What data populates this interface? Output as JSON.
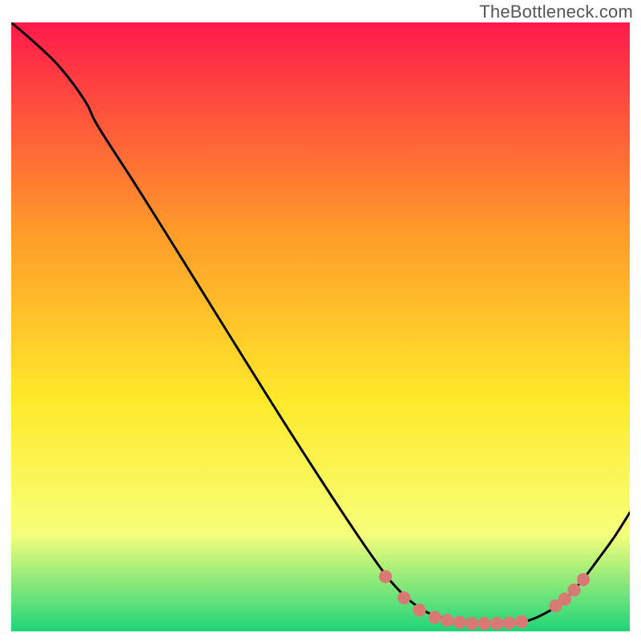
{
  "attribution": "TheBottleneck.com",
  "chart_data": {
    "type": "line",
    "title": "",
    "xlabel": "",
    "ylabel": "",
    "xlim": [
      0,
      100
    ],
    "ylim": [
      0,
      100
    ],
    "gradient_colors": {
      "top": "#ff1a4b",
      "mid_upper": "#ff9a2a",
      "mid": "#ffe92a",
      "mid_lower": "#f6ff7a",
      "bottom": "#1fd47a"
    },
    "curve_points": [
      {
        "x": 0.0,
        "y": 100.0
      },
      {
        "x": 4.0,
        "y": 96.5
      },
      {
        "x": 8.0,
        "y": 92.5
      },
      {
        "x": 12.0,
        "y": 87.0
      },
      {
        "x": 14.0,
        "y": 83.0
      },
      {
        "x": 20.0,
        "y": 73.5
      },
      {
        "x": 26.0,
        "y": 63.8
      },
      {
        "x": 32.0,
        "y": 54.0
      },
      {
        "x": 38.0,
        "y": 44.2
      },
      {
        "x": 44.0,
        "y": 34.5
      },
      {
        "x": 50.0,
        "y": 25.0
      },
      {
        "x": 56.0,
        "y": 15.8
      },
      {
        "x": 60.0,
        "y": 10.0
      },
      {
        "x": 62.0,
        "y": 7.5
      },
      {
        "x": 64.5,
        "y": 5.0
      },
      {
        "x": 67.5,
        "y": 3.0
      },
      {
        "x": 71.0,
        "y": 1.8
      },
      {
        "x": 74.0,
        "y": 1.3
      },
      {
        "x": 77.0,
        "y": 1.3
      },
      {
        "x": 80.0,
        "y": 1.3
      },
      {
        "x": 83.0,
        "y": 1.6
      },
      {
        "x": 86.0,
        "y": 2.8
      },
      {
        "x": 89.0,
        "y": 4.8
      },
      {
        "x": 92.0,
        "y": 8.0
      },
      {
        "x": 95.0,
        "y": 12.0
      },
      {
        "x": 97.5,
        "y": 15.5
      },
      {
        "x": 100.0,
        "y": 19.5
      }
    ],
    "dot_points": [
      {
        "x": 60.5,
        "y": 9.0
      },
      {
        "x": 63.5,
        "y": 5.5
      },
      {
        "x": 66.0,
        "y": 3.5
      },
      {
        "x": 68.5,
        "y": 2.3
      },
      {
        "x": 70.5,
        "y": 1.8
      },
      {
        "x": 72.5,
        "y": 1.5
      },
      {
        "x": 74.5,
        "y": 1.3
      },
      {
        "x": 76.5,
        "y": 1.3
      },
      {
        "x": 78.5,
        "y": 1.3
      },
      {
        "x": 80.5,
        "y": 1.4
      },
      {
        "x": 82.5,
        "y": 1.6
      },
      {
        "x": 88.0,
        "y": 4.2
      },
      {
        "x": 89.5,
        "y": 5.3
      },
      {
        "x": 91.0,
        "y": 6.8
      },
      {
        "x": 92.5,
        "y": 8.5
      }
    ],
    "dot_radius": 7.6
  }
}
